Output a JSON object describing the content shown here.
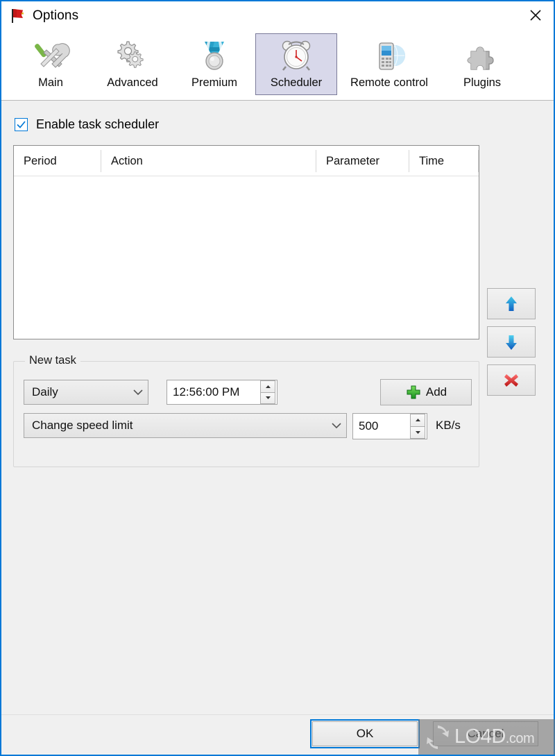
{
  "window": {
    "title": "Options",
    "app_icon": "fdm-flag-icon",
    "close_label": "×"
  },
  "toolbar": {
    "tabs": [
      {
        "label": "Main",
        "icon": "tools-icon",
        "selected": false
      },
      {
        "label": "Advanced",
        "icon": "gears-icon",
        "selected": false
      },
      {
        "label": "Premium",
        "icon": "medal-icon",
        "selected": false
      },
      {
        "label": "Scheduler",
        "icon": "alarm-clock-icon",
        "selected": true
      },
      {
        "label": "Remote control",
        "icon": "phone-globe-icon",
        "selected": false
      },
      {
        "label": "Plugins",
        "icon": "puzzle-piece-icon",
        "selected": false
      }
    ]
  },
  "scheduler": {
    "enable_checkbox": {
      "label": "Enable task scheduler",
      "checked": true
    },
    "list": {
      "columns": [
        "Period",
        "Action",
        "Parameter",
        "Time"
      ],
      "rows": []
    },
    "side_buttons": [
      {
        "name": "move-up",
        "icon": "arrow-up-icon",
        "color": "#1a9ddb"
      },
      {
        "name": "move-down",
        "icon": "arrow-down-icon",
        "color": "#1a7fd4"
      },
      {
        "name": "delete",
        "icon": "red-x-icon",
        "color": "#d32020"
      }
    ],
    "new_task": {
      "title": "New task",
      "period_value": "Daily",
      "time_value": "12:56:00 PM",
      "add_label": "Add",
      "action_value": "Change speed limit",
      "speed_value": "500",
      "unit_label": "KB/s"
    }
  },
  "footer": {
    "ok_label": "OK",
    "cancel_label": "Cancel"
  },
  "watermark": {
    "text": "LO4D",
    "suffix": ".com"
  },
  "colors": {
    "window_border": "#0078d7",
    "accent": "#0078d7",
    "dialog_bg": "#f0f0f0",
    "tab_selected_bg": "#d8d8ea"
  }
}
